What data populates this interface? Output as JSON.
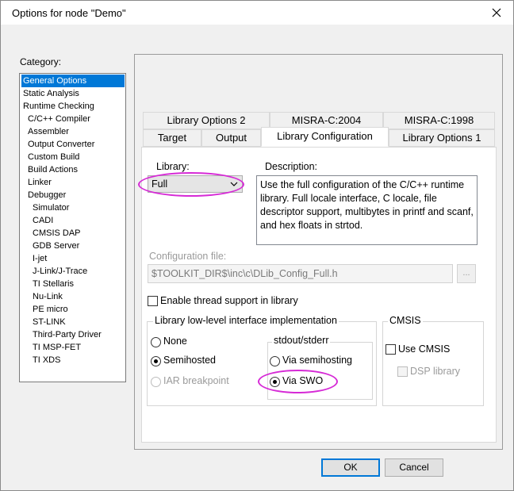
{
  "window": {
    "title": "Options for node \"Demo\""
  },
  "category": {
    "label": "Category:",
    "items": [
      "General Options",
      "Static Analysis",
      "Runtime Checking",
      "C/C++ Compiler",
      "Assembler",
      "Output Converter",
      "Custom Build",
      "Build Actions",
      "Linker",
      "Debugger",
      "Simulator",
      "CADI",
      "CMSIS DAP",
      "GDB Server",
      "I-jet",
      "J-Link/J-Trace",
      "TI Stellaris",
      "Nu-Link",
      "PE micro",
      "ST-LINK",
      "Third-Party Driver",
      "TI MSP-FET",
      "TI XDS"
    ],
    "selected": "General Options"
  },
  "tabs": {
    "row_back": [
      "Library Options 2",
      "MISRA-C:2004",
      "MISRA-C:1998"
    ],
    "row_front": [
      "Target",
      "Output",
      "Library Configuration",
      "Library Options 1"
    ],
    "active": "Library Configuration"
  },
  "library": {
    "label": "Library:",
    "value": "Full"
  },
  "description": {
    "label": "Description:",
    "text": "Use the full configuration of the C/C++ runtime library. Full locale interface, C locale, file descriptor support, multibytes in printf and scanf, and hex floats in strtod."
  },
  "config_file": {
    "label": "Configuration file:",
    "value": "$TOOLKIT_DIR$\\inc\\c\\DLib_Config_Full.h",
    "browse_label": "..."
  },
  "thread_support": {
    "label": "Enable thread support in library",
    "checked": false
  },
  "low_level": {
    "legend": "Library low-level interface implementation",
    "options": [
      "None",
      "Semihosted",
      "IAR breakpoint"
    ],
    "selected": "Semihosted"
  },
  "stdout": {
    "legend": "stdout/stderr",
    "options": [
      "Via semihosting",
      "Via SWO"
    ],
    "selected": "Via SWO"
  },
  "cmsis": {
    "legend": "CMSIS",
    "use_cmsis": "Use CMSIS",
    "dsp_library": "DSP library"
  },
  "buttons": {
    "ok": "OK",
    "cancel": "Cancel"
  },
  "colors": {
    "selection": "#0078d7",
    "highlight": "#d62ad6",
    "default_button_border": "#0078d7"
  }
}
